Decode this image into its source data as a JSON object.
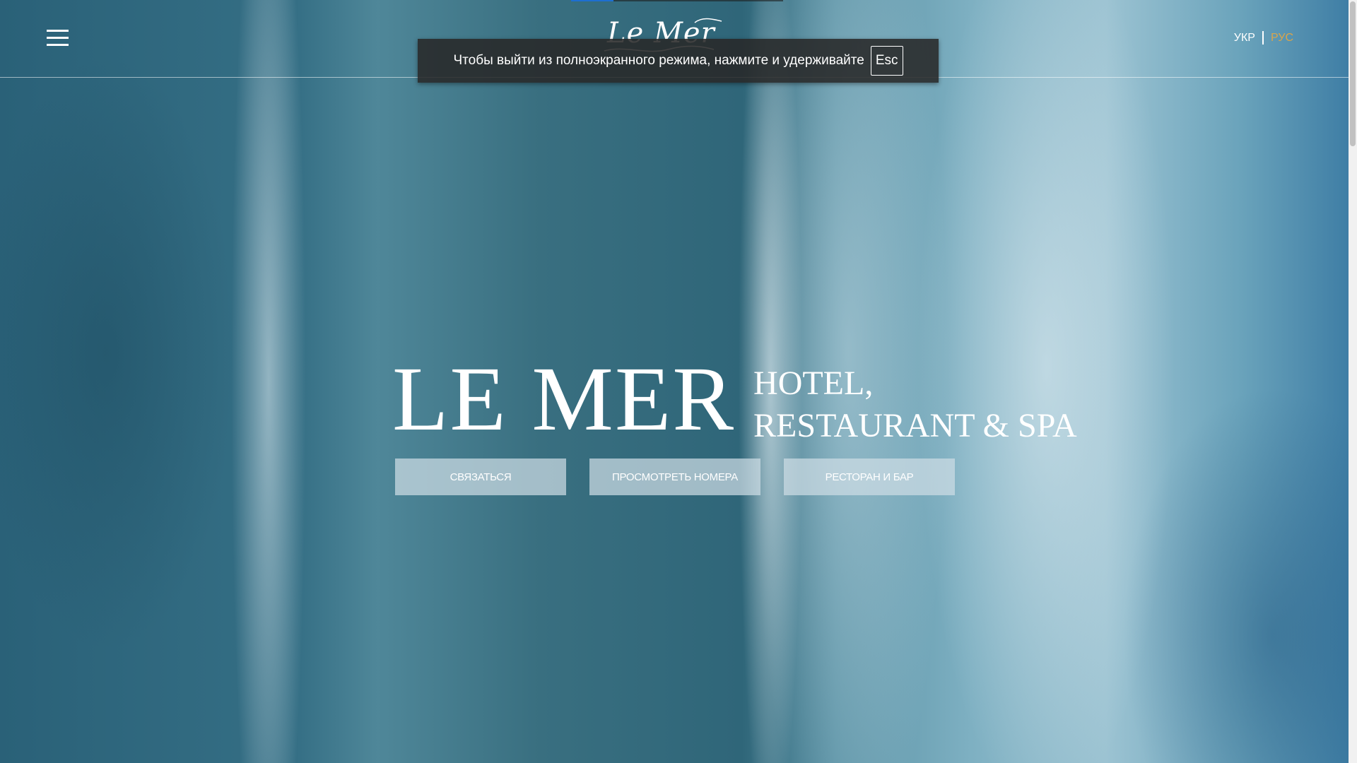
{
  "header": {
    "logo_text": "Le Mer",
    "languages": {
      "ukr": "УКР",
      "rus": "РУС",
      "active": "РУС",
      "active_color": "#d9a54b"
    }
  },
  "fullscreen_notice": {
    "message": "Чтобы выйти из полноэкранного режима, нажмите и удерживайте",
    "key": "Esc"
  },
  "hero": {
    "brand": "LE MER",
    "tagline_line1": "HOTEL,",
    "tagline_line2": "RESTAURANT & SPA",
    "buttons": {
      "contact": "СВЯЗАТЬСЯ",
      "rooms": "ПРОСМОТРЕТЬ НОМЕРА",
      "restaurant": "РЕСТОРАН И БАР"
    }
  },
  "icons": {
    "menu": "hamburger-menu-icon"
  },
  "colors": {
    "accent": "#d9a54b",
    "ocean": "#2f6a84"
  }
}
